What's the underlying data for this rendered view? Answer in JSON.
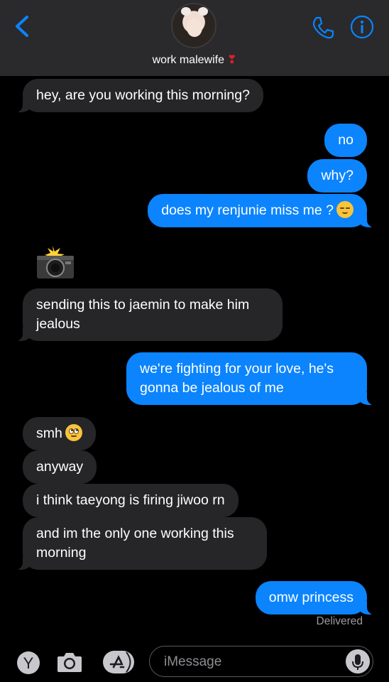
{
  "header": {
    "contact_name": "work malewife",
    "heart": "❣",
    "icons": [
      "back-chevron-icon",
      "phone-icon",
      "info-icon"
    ],
    "accent_color": "#0b84fe"
  },
  "messages": [
    {
      "from": "them",
      "text": "hey, are you working this morning?"
    },
    {
      "from": "me",
      "text": "no"
    },
    {
      "from": "me",
      "text": "why?"
    },
    {
      "from": "me",
      "text": "does my renjunie miss me ?",
      "emoji": "relieved-face"
    },
    {
      "from": "them",
      "emoji": "camera-with-flash"
    },
    {
      "from": "them",
      "text": "sending this to jaemin to make him jealous"
    },
    {
      "from": "me",
      "text": "we're fighting for your love, he's gonna be jealous of me"
    },
    {
      "from": "them",
      "text": "smh",
      "emoji": "face-with-rolling-eyes"
    },
    {
      "from": "them",
      "text": "anyway"
    },
    {
      "from": "them",
      "text": "i think taeyong is firing jiwoo rn"
    },
    {
      "from": "them",
      "text": "and im the only one working this morning"
    },
    {
      "from": "me",
      "text": "omw princess"
    }
  ],
  "status": "Delivered",
  "composer": {
    "placeholder": "iMessage",
    "icons": [
      "yelp-app-icon",
      "camera-icon",
      "app-store-icon",
      "microphone-icon"
    ]
  }
}
